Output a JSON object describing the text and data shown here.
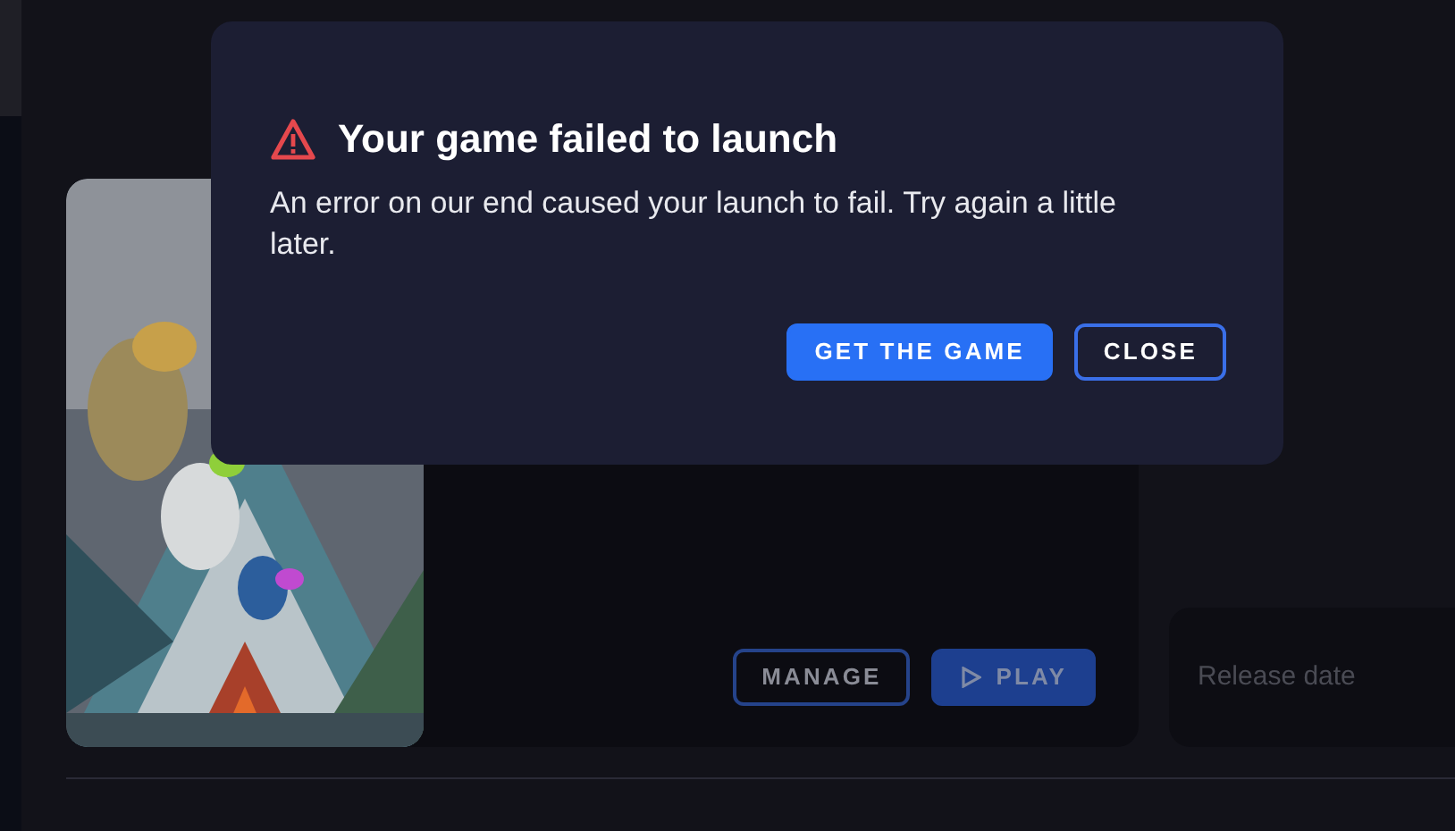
{
  "dialog": {
    "title": "Your game failed to launch",
    "message": "An error on our end caused your launch to fail. Try again a little later.",
    "buttons": [
      {
        "label": "GET THE GAME",
        "kind": "primary"
      },
      {
        "label": "CLOSE",
        "kind": "outline"
      }
    ]
  },
  "game_card": {
    "buttons": [
      {
        "label": "MANAGE",
        "kind": "outline"
      },
      {
        "label": "PLAY",
        "kind": "play"
      }
    ]
  },
  "release_card": {
    "label": "Release date"
  }
}
